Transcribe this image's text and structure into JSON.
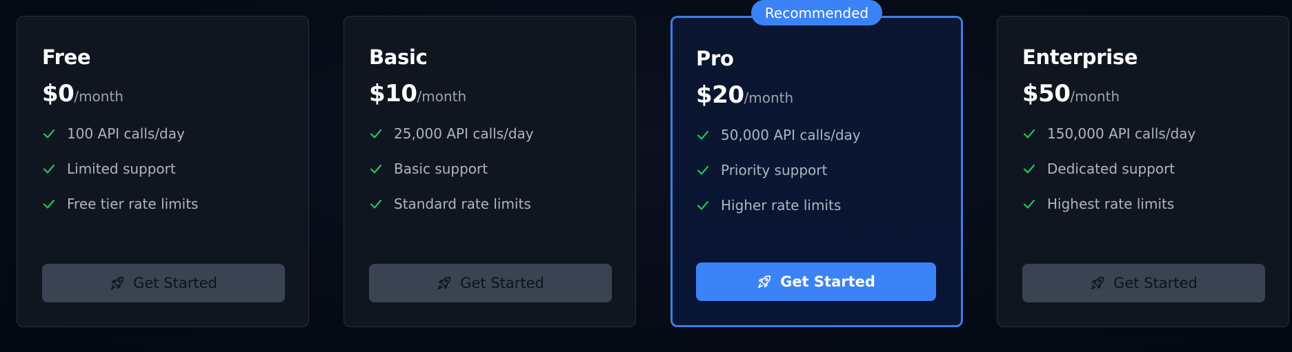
{
  "badge": {
    "label": "Recommended"
  },
  "plans": [
    {
      "name": "Free",
      "price": "$0",
      "period": "/month",
      "features": [
        "100 API calls/day",
        "Limited support",
        "Free tier rate limits"
      ],
      "button_label": "Get Started"
    },
    {
      "name": "Basic",
      "price": "$10",
      "period": "/month",
      "features": [
        "25,000 API calls/day",
        "Basic support",
        "Standard rate limits"
      ],
      "button_label": "Get Started"
    },
    {
      "name": "Pro",
      "price": "$20",
      "period": "/month",
      "features": [
        "50,000 API calls/day",
        "Priority support",
        "Higher rate limits"
      ],
      "button_label": "Get Started"
    },
    {
      "name": "Enterprise",
      "price": "$50",
      "period": "/month",
      "features": [
        "150,000 API calls/day",
        "Dedicated support",
        "Highest rate limits"
      ],
      "button_label": "Get Started"
    }
  ],
  "icons": {
    "feature": "check-icon",
    "button": "rocket-icon"
  },
  "colors": {
    "accent": "#3b82f6",
    "check": "#22c55e",
    "card_background": "#0f1620",
    "button_muted": "#3a4352"
  }
}
